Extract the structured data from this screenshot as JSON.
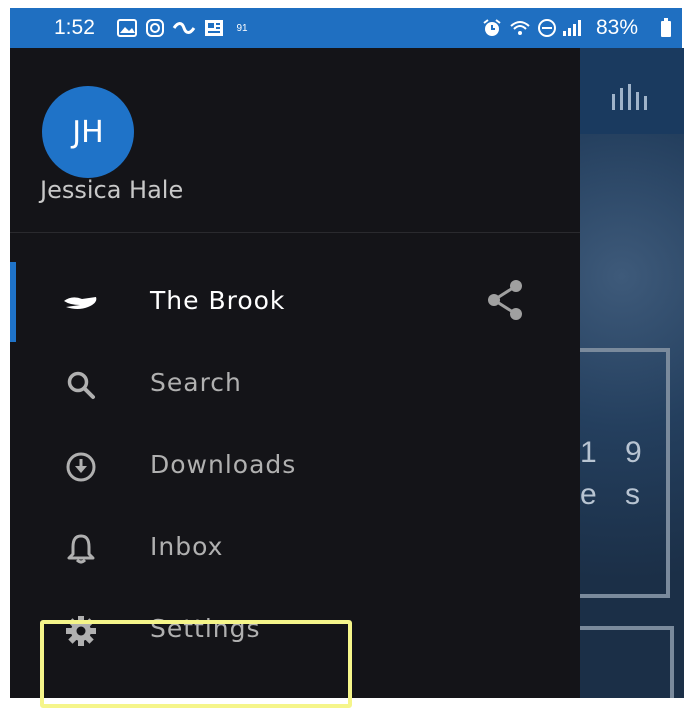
{
  "status_bar": {
    "time": "1:52",
    "notif_badge": "91",
    "battery_percent": "83%"
  },
  "drawer": {
    "avatar_initials": "JH",
    "user_name": "Jessica Hale",
    "items": [
      {
        "label": "The Brook",
        "icon": "brook-logo-icon",
        "active": true
      },
      {
        "label": "Search",
        "icon": "search-icon"
      },
      {
        "label": "Downloads",
        "icon": "download-icon"
      },
      {
        "label": "Inbox",
        "icon": "bell-icon"
      },
      {
        "label": "Settings",
        "icon": "gear-icon"
      }
    ]
  },
  "background": {
    "partial_line_1": "1 9",
    "partial_line_2": "e s"
  },
  "colors": {
    "status_bar": "#1f6fc1",
    "drawer": "#141418",
    "accent": "#1f73c8",
    "highlight": "#f5f58a"
  }
}
